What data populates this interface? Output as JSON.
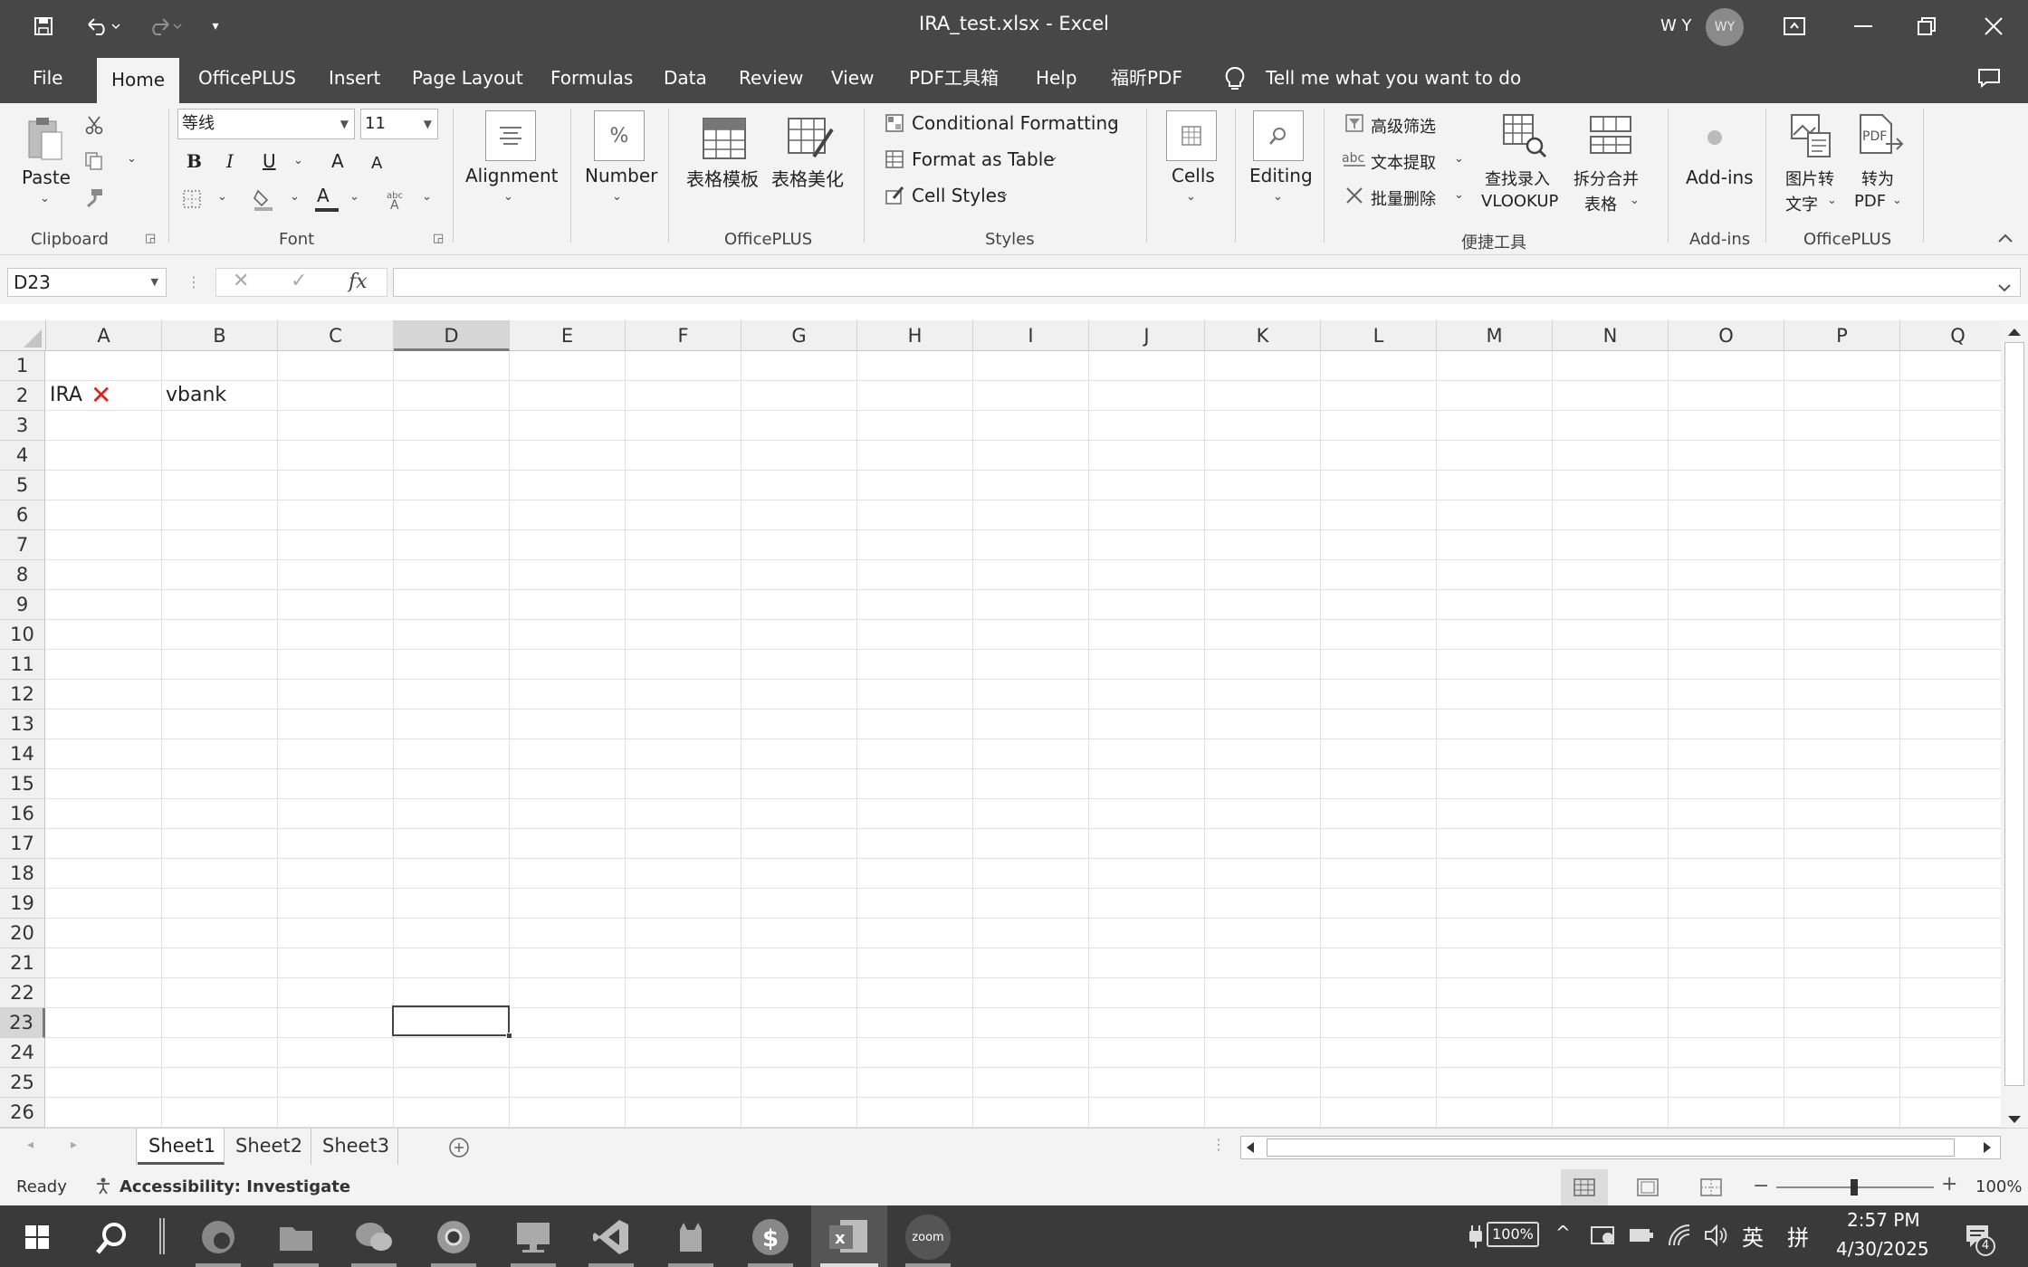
{
  "window": {
    "title": "IRA_test.xlsx  -  Excel",
    "user_name": "W Y",
    "avatar_initials": "WY"
  },
  "tabs": [
    "File",
    "Home",
    "OfficePLUS",
    "Insert",
    "Page Layout",
    "Formulas",
    "Data",
    "Review",
    "View",
    "PDF工具箱",
    "Help",
    "福昕PDF"
  ],
  "active_tab": "Home",
  "tell_me": "Tell me what you want to do",
  "ribbon": {
    "clipboard": {
      "paste": "Paste",
      "label": "Clipboard"
    },
    "font": {
      "name": "等线",
      "size": "11",
      "label": "Font",
      "bold": "B",
      "italic": "I",
      "underline": "U",
      "grow": "A",
      "shrink": "A",
      "color_letter": "A"
    },
    "alignment": {
      "label": "Alignment"
    },
    "number": {
      "label": "Number",
      "symbol": "%"
    },
    "officeplus": {
      "template": "表格模板",
      "beautify": "表格美化",
      "label": "OfficePLUS"
    },
    "styles": {
      "conditional": "Conditional Formatting",
      "format_table": "Format as Table",
      "cell_styles": "Cell Styles",
      "label": "Styles"
    },
    "cells": {
      "label": "Cells"
    },
    "editing": {
      "label": "Editing"
    },
    "quick_tools": {
      "advanced_filter": "高级筛选",
      "text_extract": "文本提取",
      "batch_delete": "批量删除",
      "lookup_line1": "查找录入",
      "lookup_line2": "VLOOKUP",
      "split_line1": "拆分合并",
      "split_line2": "表格",
      "label": "便捷工具"
    },
    "addins": {
      "button": "Add-ins",
      "label": "Add-ins"
    },
    "officeplus2": {
      "img_line1": "图片转",
      "img_line2": "文字",
      "pdf_line1": "转为",
      "pdf_line2": "PDF",
      "label": "OfficePLUS"
    }
  },
  "formula_bar": {
    "name_box": "D23",
    "fx": "fx",
    "value": ""
  },
  "columns": [
    "A",
    "B",
    "C",
    "D",
    "E",
    "F",
    "G",
    "H",
    "I",
    "J",
    "K",
    "L",
    "M",
    "N",
    "O",
    "P",
    "Q"
  ],
  "selected_column": "D",
  "rows": [
    "1",
    "2",
    "3",
    "4",
    "5",
    "6",
    "7",
    "8",
    "9",
    "10",
    "11",
    "12",
    "13",
    "14",
    "15",
    "16",
    "17",
    "18",
    "19",
    "20",
    "21",
    "22",
    "23",
    "24",
    "25",
    "26"
  ],
  "selected_row": "23",
  "cells": {
    "A2": "IRA",
    "A2_mark": "✕",
    "B2": "vbank"
  },
  "sheets": [
    "Sheet1",
    "Sheet2",
    "Sheet3"
  ],
  "active_sheet": "Sheet1",
  "status": {
    "ready": "Ready",
    "accessibility": "Accessibility: Investigate",
    "zoom": "100%"
  },
  "taskbar": {
    "battery": "100%",
    "ime_lang": "英",
    "ime_mode": "拼",
    "time": "2:57 PM",
    "date": "4/30/2025",
    "notifications": "4",
    "zoom_app": "zoom"
  },
  "colors": {
    "chrome": "#474747",
    "ribbon": "#f3f3f3",
    "error_mark": "#e02020"
  }
}
